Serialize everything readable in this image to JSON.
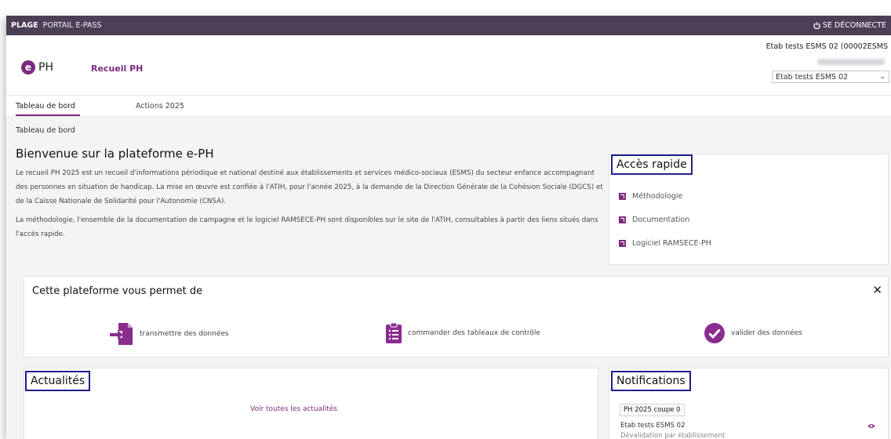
{
  "topbar": {
    "brand": "PLAGE",
    "portal": "PORTAIL E-PASS",
    "logout": "SE DÉCONNECTE"
  },
  "header": {
    "logo_mark": "e",
    "logo_text": "PH",
    "app_name": "Recueil PH",
    "etab_name": "Etab tests ESMS 02 (00002ESMS",
    "etab_select": "Etab tests ESMS 02"
  },
  "tabs": [
    {
      "label": "Tableau de bord",
      "active": true
    },
    {
      "label": "Actions 2025",
      "active": false
    }
  ],
  "breadcrumb": "Tableau de bord",
  "welcome": {
    "title": "Bienvenue sur la plateforme e-PH",
    "p1": "Le recueil PH 2025 est un recueil d'informations périodique et national destiné aux établissements et services médico-sociaux (ESMS) du secteur enfance accompagnant des personnes en situation de handicap. La mise en œuvre est confiée à l'ATIH, pour l'année 2025, à la demande de la Direction Générale de la Cohésion Sociale (DGCS) et de la Caisse Nationale de Solidarité pour l'Autonomie (CNSA).",
    "p2": "La méthodologie, l'ensemble de la documentation de campagne et le logiciel RAMSECE-PH sont disponibles sur le site de l'ATIH, consultables à partir des liens situés dans l'accès rapide."
  },
  "acces_rapide": {
    "title": "Accès rapide",
    "items": [
      {
        "label": "Méthodologie"
      },
      {
        "label": "Documentation"
      },
      {
        "label": "Logiciel RAMSECE-PH"
      }
    ]
  },
  "permet": {
    "title": "Cette plateforme vous permet de",
    "features": [
      {
        "label": "transmettre des données",
        "icon": "file-import-icon"
      },
      {
        "label": "commander des tableaux de contrôle",
        "icon": "clipboard-list-icon"
      },
      {
        "label": "valider des données",
        "icon": "check-circle-icon"
      }
    ]
  },
  "actualites": {
    "title": "Actualités",
    "link": "Voir toutes les actualités"
  },
  "notifications": {
    "title": "Notifications",
    "badge": "PH 2025 coupe 0",
    "etab": "Etab tests ESMS 02",
    "sub": "Dévalidation par établissement"
  },
  "colors": {
    "brand": "#7b2a7e",
    "topbar": "#4c3e57",
    "highlight_box": "#1f1f8c"
  }
}
